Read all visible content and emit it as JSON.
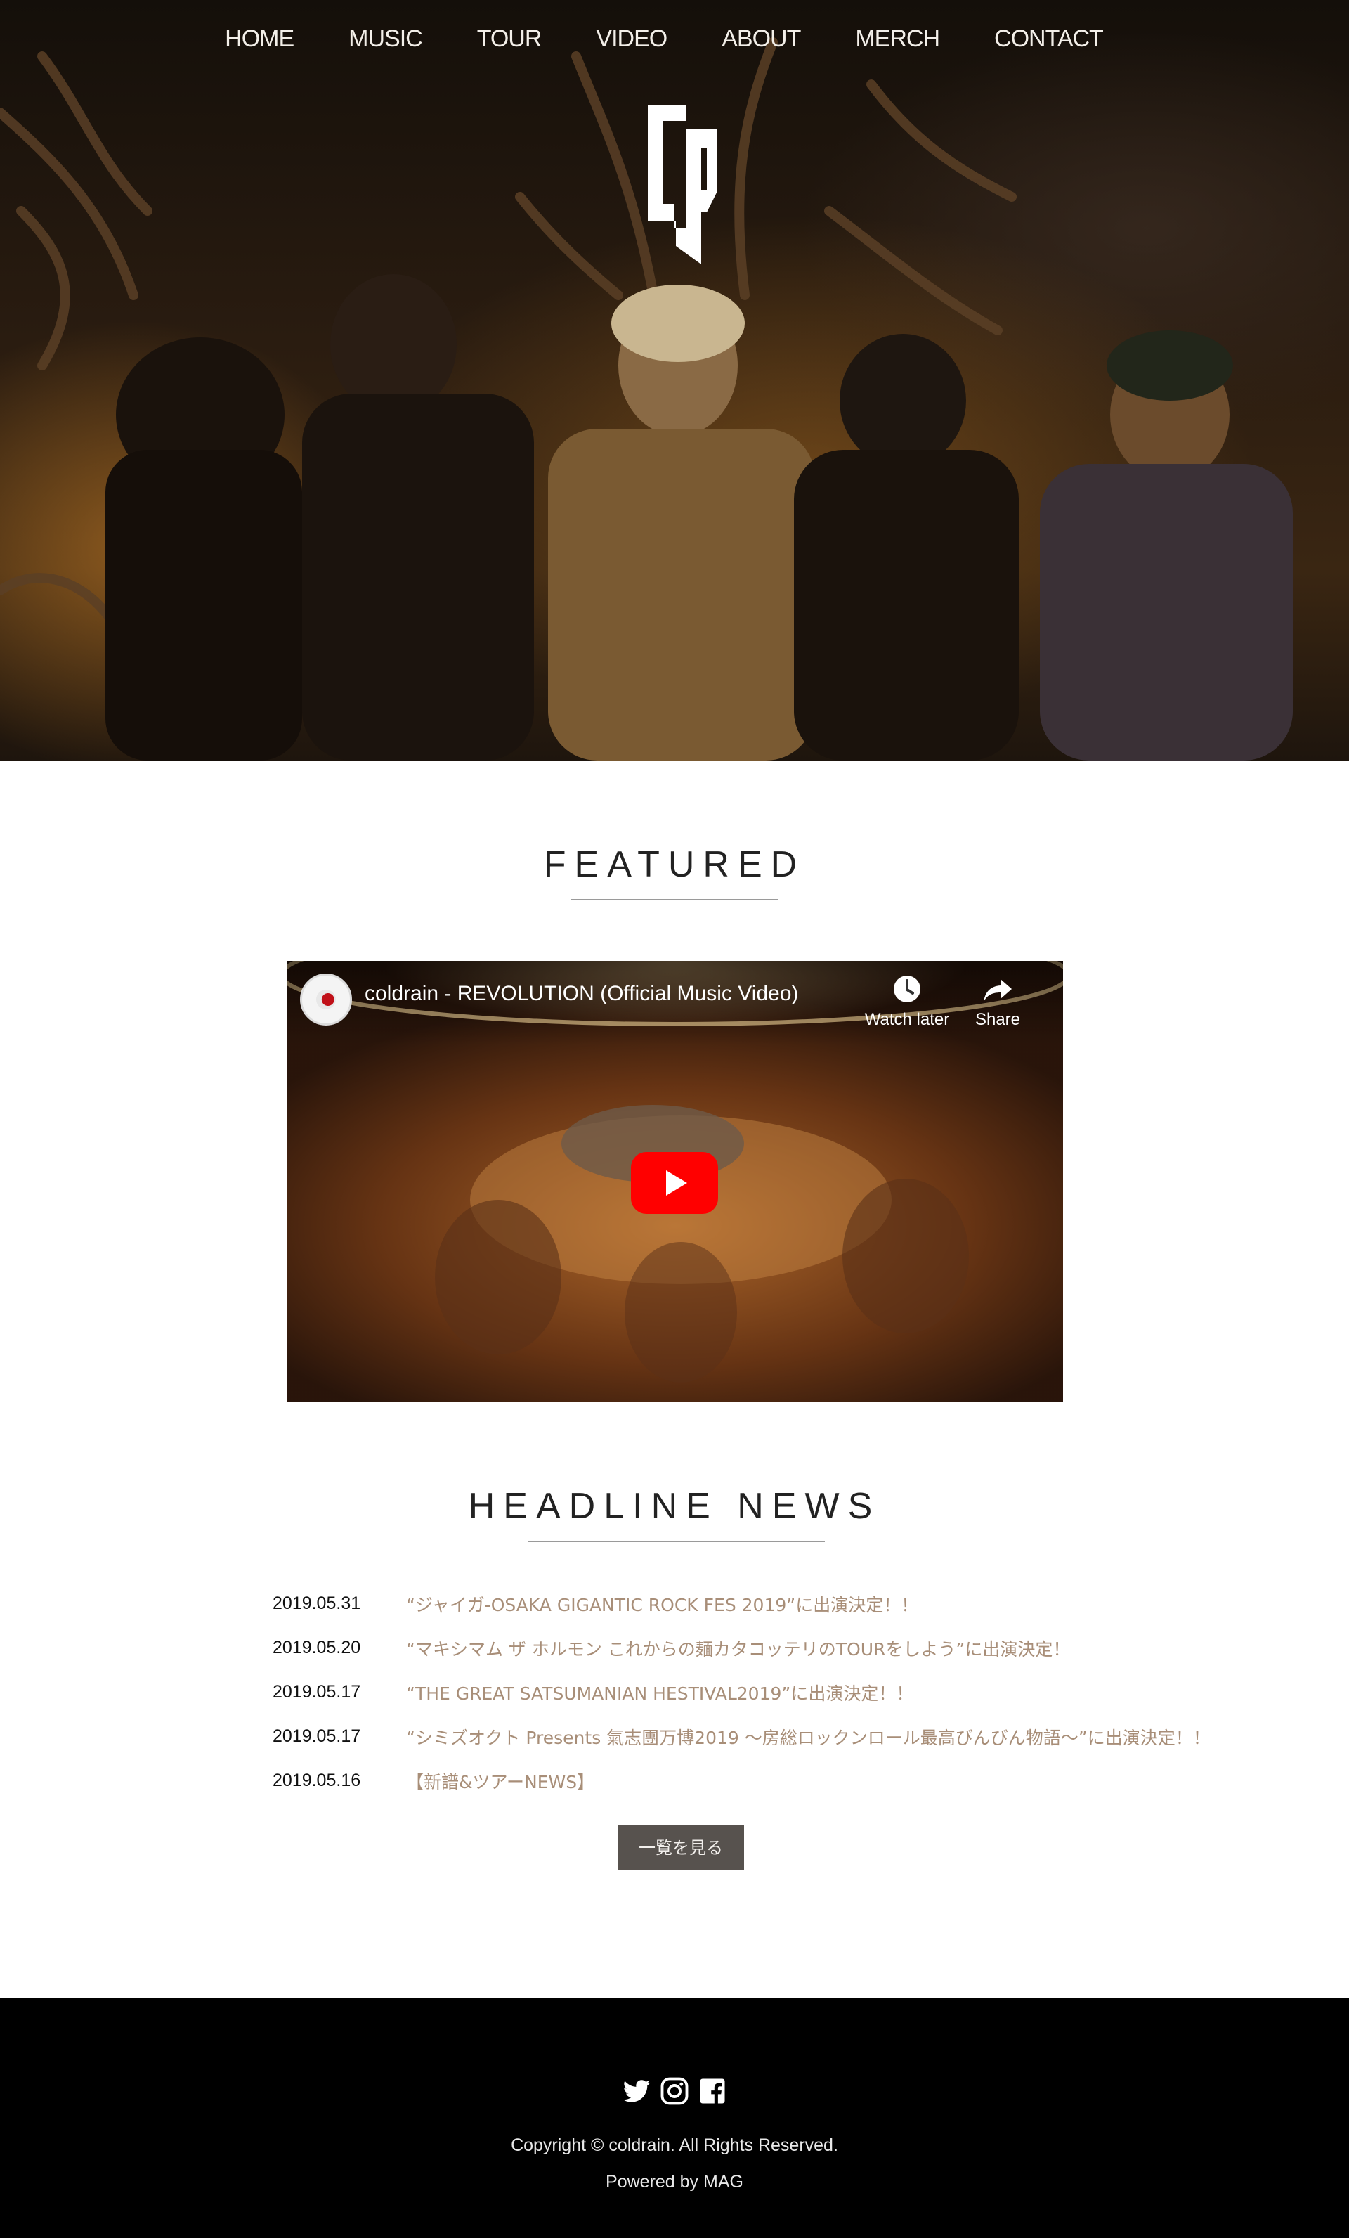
{
  "nav": {
    "items": [
      {
        "label": "HOME"
      },
      {
        "label": "MUSIC"
      },
      {
        "label": "TOUR"
      },
      {
        "label": "VIDEO"
      },
      {
        "label": "ABOUT"
      },
      {
        "label": "MERCH"
      },
      {
        "label": "CONTACT"
      }
    ]
  },
  "featured": {
    "title": "FEATURED",
    "video": {
      "title": "coldrain - REVOLUTION (Official Music Video)",
      "watch_later_label": "Watch later",
      "share_label": "Share"
    }
  },
  "news": {
    "title": "HEADLINE NEWS",
    "items": [
      {
        "date": "2019.05.31",
        "text": "“ジャイガ-OSAKA GIGANTIC ROCK FES 2019”に出演決定！！"
      },
      {
        "date": "2019.05.20",
        "text": "“マキシマム ザ ホルモン これからの麺カタコッテリのTOURをしよう”に出演決定！"
      },
      {
        "date": "2019.05.17",
        "text": "“THE GREAT SATSUMANIAN HESTIVAL2019”に出演決定！！"
      },
      {
        "date": "2019.05.17",
        "text": "“シミズオクト Presents 氣志團万博2019 ～房総ロックンロール最高びんびん物語～”に出演決定！！"
      },
      {
        "date": "2019.05.16",
        "text": "【新譜&ツアーNEWS】"
      }
    ],
    "more_label": "一覧を見る"
  },
  "footer": {
    "copyright": "Copyright © coldrain. All Rights Reserved.",
    "powered": "Powered by MAG"
  },
  "icons": {
    "twitter": "twitter-icon",
    "instagram": "instagram-icon",
    "facebook": "facebook-icon",
    "play": "play-icon",
    "clock": "clock-icon",
    "share": "share-icon"
  },
  "colors": {
    "news_link": "#a88e78",
    "more_button": "#57524e",
    "footer_bg": "#000000",
    "play_red": "#ff0000"
  }
}
